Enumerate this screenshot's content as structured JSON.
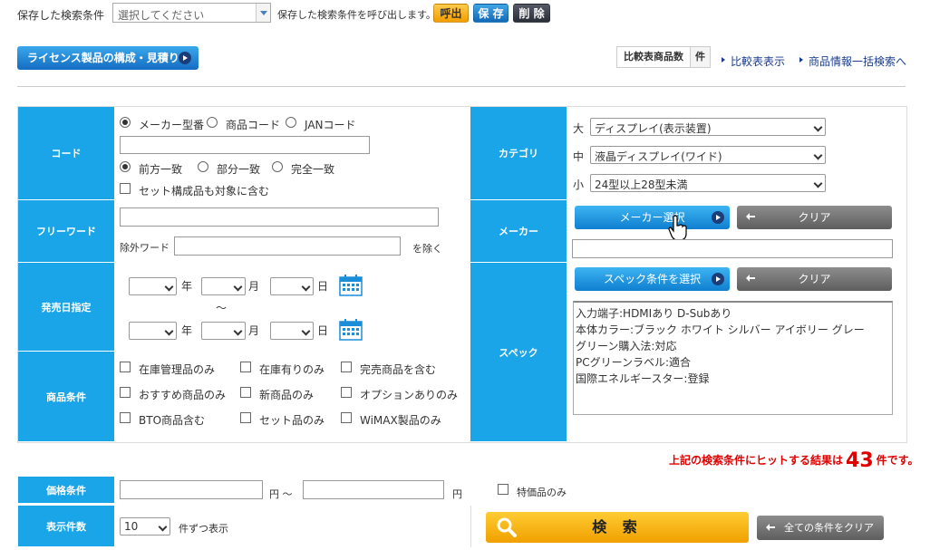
{
  "topbar": {
    "saved_label": "保存した検索条件",
    "saved_placeholder": "選択してください",
    "saved_text": "保存した検索条件を呼び出します。",
    "call_label": "呼出",
    "save_label": "保 存",
    "delete_label": "削 除"
  },
  "license_button": "ライセンス製品の構成・見積り",
  "compare": {
    "label": "比較表商品数",
    "count": "件",
    "show_link": "比較表表示",
    "bulk_link": "商品情報一括検索へ"
  },
  "code": {
    "label": "コード",
    "radio1": [
      "メーカー型番",
      "商品コード",
      "JANコード"
    ],
    "radio2": [
      "前方一致",
      "部分一致",
      "完全一致"
    ],
    "set_check": "セット構成品も対象に含む"
  },
  "freeword": {
    "label": "フリーワード",
    "exclude_label": "除外ワード",
    "exclude_suffix": "を除く"
  },
  "date": {
    "label": "発売日指定",
    "year": "年",
    "month": "月",
    "day": "日",
    "tilde": "～"
  },
  "conditions": {
    "label": "商品条件",
    "items": [
      "在庫管理品のみ",
      "在庫有りのみ",
      "完売商品を含む",
      "おすすめ商品のみ",
      "新商品のみ",
      "オプションありのみ",
      "BTO商品含む",
      "セット品のみ",
      "WiMAX製品のみ"
    ]
  },
  "category": {
    "label": "カテゴリ",
    "large_label": "大",
    "large": "ディスプレイ(表示装置)",
    "mid_label": "中",
    "mid": "液晶ディスプレイ(ワイド)",
    "small_label": "小",
    "small": "24型以上28型未満"
  },
  "maker": {
    "label": "メーカー",
    "select_label": "メーカー選択",
    "clear_label": "クリア"
  },
  "spec": {
    "label": "スペック",
    "select_label": "スペック条件を選択",
    "clear_label": "クリア",
    "lines": [
      "入力端子:HDMIあり D-Subあり",
      "本体カラー:ブラック ホワイト シルバー アイボリー グレー",
      "グリーン購入法:対応",
      "PCグリーンラベル:適合",
      "国際エネルギースター:登録"
    ]
  },
  "result": {
    "prefix": "上記の検索条件にヒットする結果は",
    "count": "43",
    "suffix": "件です。"
  },
  "price": {
    "label": "価格条件",
    "unit1": "円 ～",
    "unit2": "円",
    "special": "特価品のみ"
  },
  "display": {
    "label": "表示件数",
    "value": "10",
    "suffix": "件ずつ表示"
  },
  "search_label": "検 索",
  "clear_all_label": "全ての条件をクリア",
  "colors": {
    "accent": "#19a5e8",
    "result": "#e00000",
    "search": "#f5a800"
  }
}
